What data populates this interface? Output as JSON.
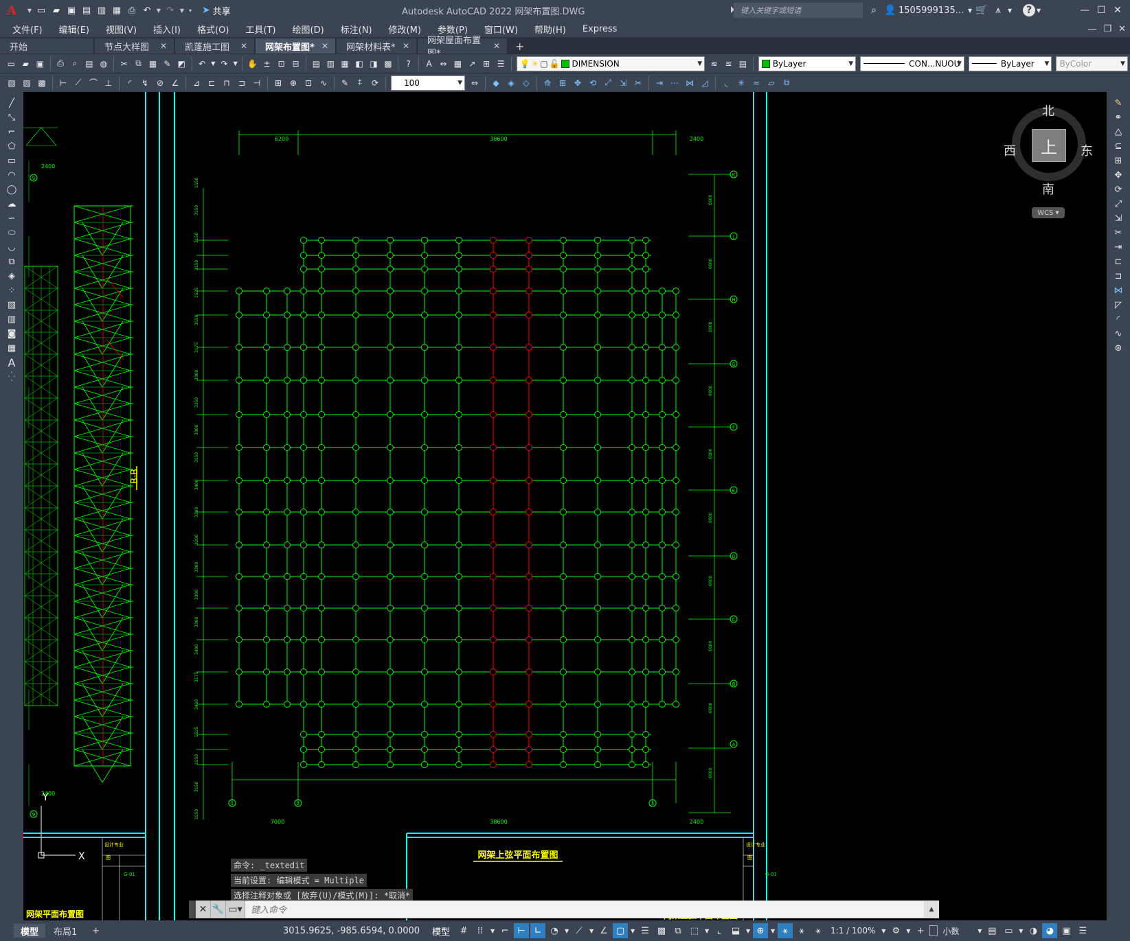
{
  "titlebar": {
    "app_title": "Autodesk AutoCAD 2022    网架布置图.DWG",
    "share_label": "共享",
    "search_placeholder": "键入关键字或短语",
    "user": "1505999135...",
    "help": "?"
  },
  "menu": [
    "文件(F)",
    "编辑(E)",
    "视图(V)",
    "插入(I)",
    "格式(O)",
    "工具(T)",
    "绘图(D)",
    "标注(N)",
    "修改(M)",
    "参数(P)",
    "窗口(W)",
    "帮助(H)",
    "Express"
  ],
  "tabs": [
    {
      "label": "开始",
      "closable": false,
      "active": false,
      "w": 136
    },
    {
      "label": "节点大样图",
      "closable": true,
      "active": false,
      "w": 115
    },
    {
      "label": "凯蓬施工图",
      "closable": true,
      "active": false,
      "w": 115
    },
    {
      "label": "网架布置图*",
      "closable": true,
      "active": true,
      "w": 116
    },
    {
      "label": "网架材料表*",
      "closable": true,
      "active": false,
      "w": 116
    },
    {
      "label": "网架屋面布置图*",
      "closable": true,
      "active": false,
      "w": 130
    }
  ],
  "properties": {
    "layer": "DIMENSION",
    "color": "ByLayer",
    "linetype": "CON...NUOU",
    "lineweight": "ByLayer",
    "plotstyle": "ByColor",
    "scale": "100"
  },
  "viewcube": {
    "north": "北",
    "south": "南",
    "east": "东",
    "west": "西",
    "face": "上",
    "wcs": "WCS"
  },
  "drawing": {
    "title_main": "网架上弦平面布置图",
    "title_left": "网架平面布置图",
    "title_right": "网架上弦平面布置图",
    "section_label": "B-B",
    "dim_top": [
      "6200",
      "38600",
      "2400"
    ],
    "dim_bottom": [
      "7000",
      "38600",
      "2400"
    ],
    "dim_left_small": "2400",
    "axis_cols": [
      "1",
      "2",
      "3"
    ],
    "axis_rows": [
      "K",
      "J",
      "H",
      "G",
      "F",
      "E",
      "D",
      "C",
      "B",
      "A"
    ],
    "left_axis": "9",
    "ucs_y": "Y",
    "ucs_x": "X",
    "title_block": {
      "designer": "设计专业",
      "sheet": "图",
      "code": "G-01"
    }
  },
  "command_history": [
    "命令: _textedit",
    "当前设置: 编辑模式 = Multiple",
    "选择注释对象或 [放弃(U)/模式(M)]: *取消*"
  ],
  "command_placeholder": "键入命令",
  "layout_tabs": [
    {
      "label": "模型",
      "active": true
    },
    {
      "label": "布局1",
      "active": false
    }
  ],
  "status": {
    "coords": "3015.9625, -985.6594, 0.0000",
    "model": "模型",
    "annotation_scale": "1:1 / 100%",
    "units": "小数"
  },
  "colors": {
    "panel": "#3b4453",
    "drawing_green": "#00ff00",
    "drawing_red": "#ff0000",
    "frame_cyan": "#00ffff",
    "title_yellow": "#ffff00"
  }
}
